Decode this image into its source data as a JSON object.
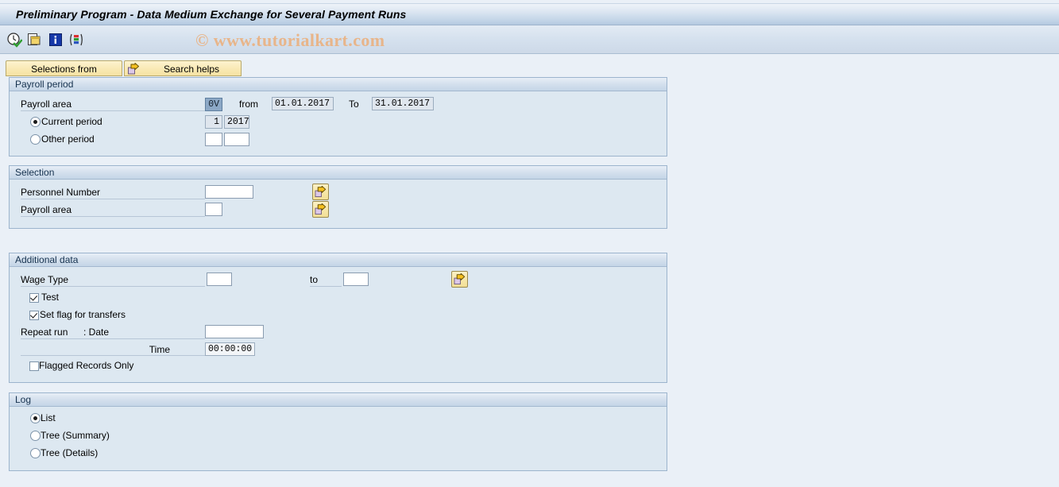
{
  "window": {
    "title": "Preliminary Program - Data Medium Exchange for Several Payment Runs"
  },
  "watermark": "© www.tutorialkart.com",
  "toolbar": {
    "icons": [
      {
        "name": "execute-clock-icon",
        "title": "Execute"
      },
      {
        "name": "copy-variant-icon",
        "title": "Get Variant"
      },
      {
        "name": "info-icon",
        "title": "Information"
      },
      {
        "name": "multiple-selection-icon",
        "title": "Multiple Selection"
      }
    ]
  },
  "tabs": [
    {
      "label": "Selections from",
      "icon": null
    },
    {
      "label": "Search helps",
      "icon": "arrow-right-icon"
    }
  ],
  "sections": {
    "payroll_period": {
      "title": "Payroll period",
      "payroll_area_label": "Payroll area",
      "payroll_area_value": "0V",
      "from_label": "from",
      "from_value": "01.01.2017",
      "to_label": "To",
      "to_value": "31.01.2017",
      "current_period_label": "Current period",
      "current_period_selected": true,
      "current_period_number": "1",
      "current_period_year": "2017",
      "other_period_label": "Other period",
      "other_period_selected": false,
      "other_period_number": "",
      "other_period_year": ""
    },
    "selection": {
      "title": "Selection",
      "personnel_number_label": "Personnel Number",
      "personnel_number_value": "",
      "payroll_area_label": "Payroll area",
      "payroll_area_value": "",
      "multi_select_icon": "arrow-right-icon"
    },
    "additional_data": {
      "title": "Additional data",
      "wage_type_label": "Wage Type",
      "wage_type_from": "",
      "wage_type_to_label": "to",
      "wage_type_to": "",
      "test_label": "Test",
      "test_checked": true,
      "set_flag_label": "Set flag for transfers",
      "set_flag_checked": true,
      "repeat_run_label": "Repeat run",
      "repeat_run_date_label": ": Date",
      "repeat_run_date_value": "",
      "time_label": "Time",
      "time_value": "00:00:00",
      "flagged_records_label": "Flagged Records Only",
      "flagged_records_checked": false
    },
    "log": {
      "title": "Log",
      "options": [
        {
          "label": "List",
          "selected": true
        },
        {
          "label": "Tree (Summary)",
          "selected": false
        },
        {
          "label": "Tree (Details)",
          "selected": false
        }
      ]
    }
  },
  "colors": {
    "page_background": "#eaf0f7",
    "panel_background": "#dde8f1",
    "panel_border": "#9cb4cd",
    "tab_yellow": "#f9e9b4",
    "watermark": "#e8b58a",
    "selected_field": "#8ca8c6"
  }
}
